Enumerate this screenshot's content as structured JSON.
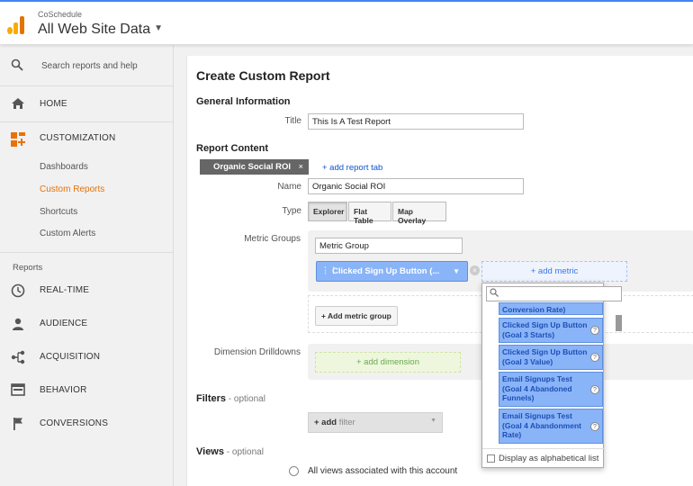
{
  "header": {
    "account_name": "CoSchedule",
    "property_name": "All Web Site Data"
  },
  "colors": {
    "accent_orange": "#e8710a",
    "link_blue": "#1155cc",
    "metric_blue": "#8ab4f8",
    "dimension_green": "#eef7dd"
  },
  "sidebar": {
    "search_placeholder": "Search reports and help",
    "home": "HOME",
    "customization": "CUSTOMIZATION",
    "customization_items": [
      "Dashboards",
      "Custom Reports",
      "Shortcuts",
      "Custom Alerts"
    ],
    "active_item": "Custom Reports",
    "reports_heading": "Reports",
    "report_items": [
      "REAL-TIME",
      "AUDIENCE",
      "ACQUISITION",
      "BEHAVIOR",
      "CONVERSIONS"
    ]
  },
  "main": {
    "page_title": "Create Custom Report",
    "general_heading": "General Information",
    "title_label": "Title",
    "title_value": "This Is A Test Report",
    "report_content_heading": "Report Content",
    "tab_label": "Organic Social ROI",
    "tab_close": "×",
    "add_tab": "+ add report tab",
    "name_label": "Name",
    "name_value": "Organic Social ROI",
    "type_label": "Type",
    "types": [
      "Explorer",
      "Flat Table",
      "Map Overlay"
    ],
    "selected_type": "Explorer",
    "metric_groups_label": "Metric Groups",
    "metric_group_value": "Metric Group",
    "metric_chip": "Clicked Sign Up Button (...",
    "add_metric": "+ add metric",
    "add_metric_group": "+ Add metric group",
    "dimension_label": "Dimension Drilldowns",
    "add_dimension": "+ add dimension",
    "filters_heading": "Filters",
    "filters_optional": " - optional",
    "add_filter_plus": "+ add",
    "add_filter_word": " filter",
    "views_heading": "Views",
    "views_optional": " - optional",
    "views_option": "All views associated with this account"
  },
  "dropdown": {
    "search_value": "",
    "options": [
      "Conversion Rate)",
      "Clicked Sign Up Button (Goal 3 Starts)",
      "Clicked Sign Up Button (Goal 3 Value)",
      "Email Signups Test (Goal 4 Abandoned Funnels)",
      "Email Signups Test (Goal 4 Abandonment Rate)"
    ],
    "help_glyph": "?",
    "alphabetical_label": "Display as alphabetical list"
  }
}
